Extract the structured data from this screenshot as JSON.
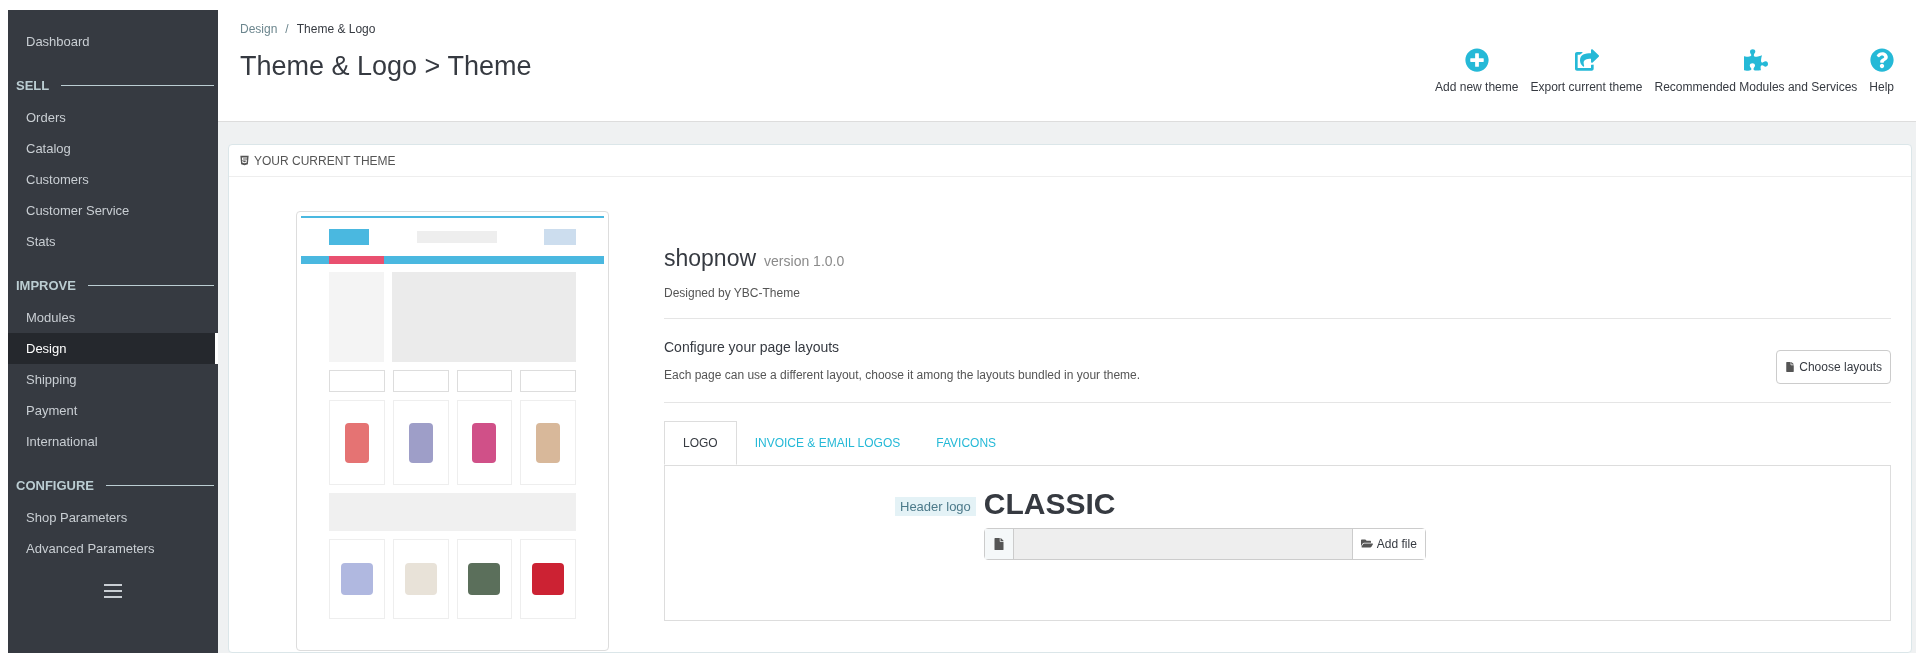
{
  "sidebar": {
    "items": [
      {
        "kind": "link",
        "label": "Dashboard",
        "selected": false
      },
      {
        "kind": "section",
        "label": "SELL"
      },
      {
        "kind": "link",
        "label": "Orders",
        "selected": false
      },
      {
        "kind": "link",
        "label": "Catalog",
        "selected": false
      },
      {
        "kind": "link",
        "label": "Customers",
        "selected": false
      },
      {
        "kind": "link",
        "label": "Customer Service",
        "selected": false
      },
      {
        "kind": "link",
        "label": "Stats",
        "selected": false
      },
      {
        "kind": "section",
        "label": "IMPROVE"
      },
      {
        "kind": "link",
        "label": "Modules",
        "selected": false
      },
      {
        "kind": "link",
        "label": "Design",
        "selected": true
      },
      {
        "kind": "link",
        "label": "Shipping",
        "selected": false
      },
      {
        "kind": "link",
        "label": "Payment",
        "selected": false
      },
      {
        "kind": "link",
        "label": "International",
        "selected": false
      },
      {
        "kind": "section",
        "label": "CONFIGURE"
      },
      {
        "kind": "link",
        "label": "Shop Parameters",
        "selected": false
      },
      {
        "kind": "link",
        "label": "Advanced Parameters",
        "selected": false
      }
    ]
  },
  "header": {
    "breadcrumb": [
      "Design",
      "Theme & Logo"
    ],
    "breadcrumb_separator": "/",
    "title": "Theme & Logo > Theme",
    "toolbar": [
      {
        "kind": "add",
        "label": "Add new theme"
      },
      {
        "kind": "export",
        "label": "Export current theme"
      },
      {
        "kind": "puzzle",
        "label": "Recommended Modules and Services"
      },
      {
        "kind": "help",
        "label": "Help"
      }
    ]
  },
  "panel": {
    "heading": "YOUR CURRENT THEME",
    "theme": {
      "name": "shopnow",
      "version": "version 1.0.0",
      "designer": "Designed by YBC-Theme"
    },
    "layouts": {
      "title": "Configure your page layouts",
      "description": "Each page can use a different layout, choose it among the layouts bundled in your theme.",
      "button": "Choose layouts"
    },
    "tabs": [
      {
        "label": "LOGO",
        "selected": true
      },
      {
        "label": "INVOICE & EMAIL LOGOS",
        "selected": false
      },
      {
        "label": "FAVICONS",
        "selected": false
      }
    ],
    "logo": {
      "label": "Header logo",
      "current": "CLASSIC",
      "add_button": "Add file"
    }
  }
}
